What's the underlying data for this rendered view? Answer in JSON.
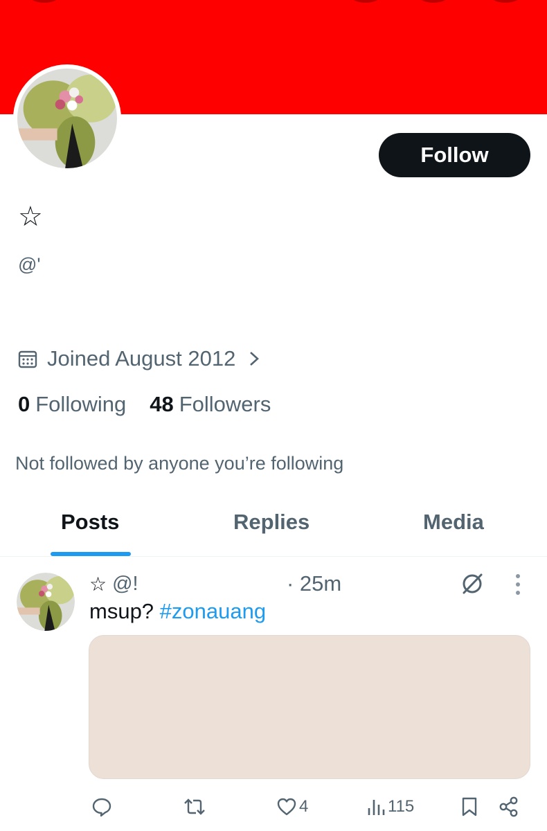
{
  "colors": {
    "banner": "#ff0000",
    "primary_text": "#0f1419",
    "secondary_text": "#536471",
    "accent": "#1d9bf0",
    "media_placeholder": "#ece0d7"
  },
  "profile": {
    "display_name": "☆",
    "handle": "@'",
    "follow_label": "Follow",
    "joined": "Joined August 2012",
    "following_count": "0",
    "following_label": "Following",
    "followers_count": "48",
    "followers_label": "Followers",
    "not_followed_text": "Not followed by anyone you’re following",
    "avatar_icon": "avatar-bouquet"
  },
  "tabs": [
    {
      "label": "Posts",
      "active": true
    },
    {
      "label": "Replies",
      "active": false
    },
    {
      "label": "Media",
      "active": false
    }
  ],
  "post": {
    "author_star": "☆",
    "handle": "@!",
    "time": "· 25m",
    "text": "msup? ",
    "hashtag": "#zonauang",
    "likes": "4",
    "views": "115",
    "icons": [
      "reply-icon",
      "repost-icon",
      "like-icon",
      "views-icon",
      "bookmark-icon",
      "share-icon",
      "grok-icon",
      "more-icon"
    ]
  }
}
